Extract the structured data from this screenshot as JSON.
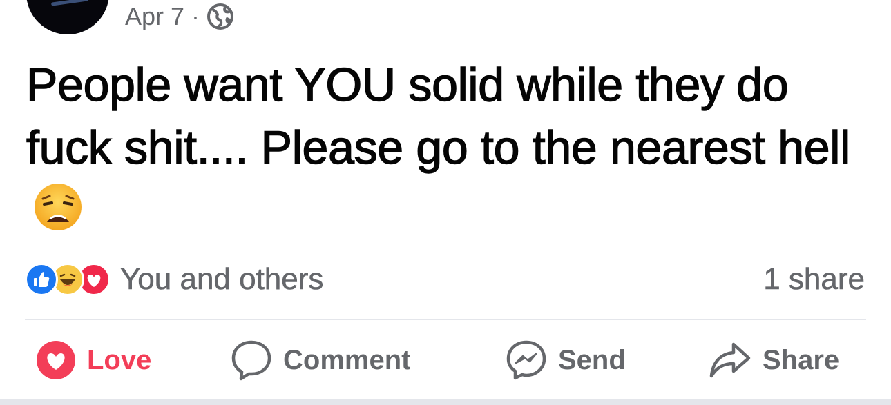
{
  "post": {
    "date": "Apr 7",
    "separator": "·",
    "audience_icon": "globe-icon",
    "text": "People want YOU solid while they do fuck shit.... Please go to the nearest hell",
    "emoji": "weary-face-emoji"
  },
  "reactions": {
    "icons": [
      "like-icon",
      "haha-icon",
      "love-icon"
    ],
    "summary": "You and others",
    "share_count": "1 share"
  },
  "actions": {
    "love": "Love",
    "comment": "Comment",
    "send": "Send",
    "share": "Share"
  },
  "colors": {
    "like_blue": "#1a77f2",
    "love_red": "#f33e58",
    "haha_yellow": "#f7c844",
    "meta_gray": "#65676b",
    "text": "#050505"
  }
}
